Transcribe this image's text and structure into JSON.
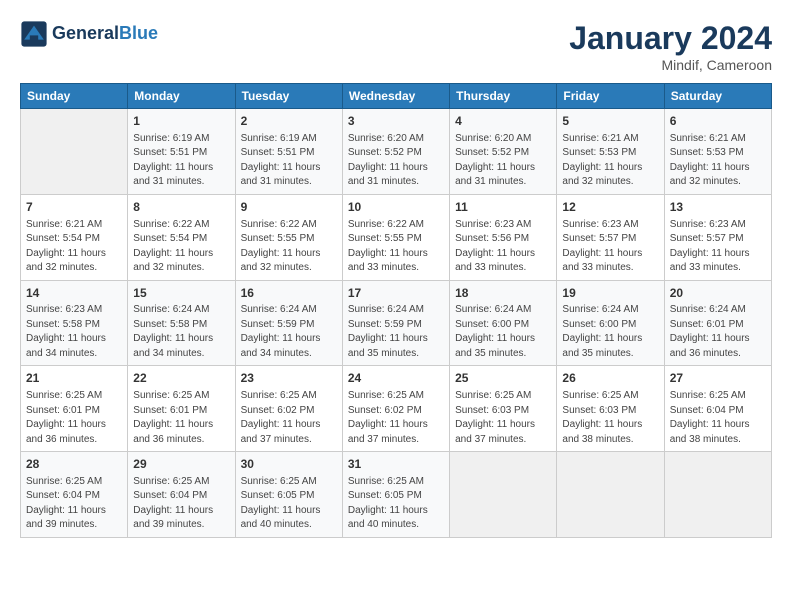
{
  "header": {
    "logo_general": "General",
    "logo_blue": "Blue",
    "month_title": "January 2024",
    "location": "Mindif, Cameroon"
  },
  "weekdays": [
    "Sunday",
    "Monday",
    "Tuesday",
    "Wednesday",
    "Thursday",
    "Friday",
    "Saturday"
  ],
  "weeks": [
    [
      {
        "day": "",
        "info": ""
      },
      {
        "day": "1",
        "info": "Sunrise: 6:19 AM\nSunset: 5:51 PM\nDaylight: 11 hours\nand 31 minutes."
      },
      {
        "day": "2",
        "info": "Sunrise: 6:19 AM\nSunset: 5:51 PM\nDaylight: 11 hours\nand 31 minutes."
      },
      {
        "day": "3",
        "info": "Sunrise: 6:20 AM\nSunset: 5:52 PM\nDaylight: 11 hours\nand 31 minutes."
      },
      {
        "day": "4",
        "info": "Sunrise: 6:20 AM\nSunset: 5:52 PM\nDaylight: 11 hours\nand 31 minutes."
      },
      {
        "day": "5",
        "info": "Sunrise: 6:21 AM\nSunset: 5:53 PM\nDaylight: 11 hours\nand 32 minutes."
      },
      {
        "day": "6",
        "info": "Sunrise: 6:21 AM\nSunset: 5:53 PM\nDaylight: 11 hours\nand 32 minutes."
      }
    ],
    [
      {
        "day": "7",
        "info": "Sunrise: 6:21 AM\nSunset: 5:54 PM\nDaylight: 11 hours\nand 32 minutes."
      },
      {
        "day": "8",
        "info": "Sunrise: 6:22 AM\nSunset: 5:54 PM\nDaylight: 11 hours\nand 32 minutes."
      },
      {
        "day": "9",
        "info": "Sunrise: 6:22 AM\nSunset: 5:55 PM\nDaylight: 11 hours\nand 32 minutes."
      },
      {
        "day": "10",
        "info": "Sunrise: 6:22 AM\nSunset: 5:55 PM\nDaylight: 11 hours\nand 33 minutes."
      },
      {
        "day": "11",
        "info": "Sunrise: 6:23 AM\nSunset: 5:56 PM\nDaylight: 11 hours\nand 33 minutes."
      },
      {
        "day": "12",
        "info": "Sunrise: 6:23 AM\nSunset: 5:57 PM\nDaylight: 11 hours\nand 33 minutes."
      },
      {
        "day": "13",
        "info": "Sunrise: 6:23 AM\nSunset: 5:57 PM\nDaylight: 11 hours\nand 33 minutes."
      }
    ],
    [
      {
        "day": "14",
        "info": "Sunrise: 6:23 AM\nSunset: 5:58 PM\nDaylight: 11 hours\nand 34 minutes."
      },
      {
        "day": "15",
        "info": "Sunrise: 6:24 AM\nSunset: 5:58 PM\nDaylight: 11 hours\nand 34 minutes."
      },
      {
        "day": "16",
        "info": "Sunrise: 6:24 AM\nSunset: 5:59 PM\nDaylight: 11 hours\nand 34 minutes."
      },
      {
        "day": "17",
        "info": "Sunrise: 6:24 AM\nSunset: 5:59 PM\nDaylight: 11 hours\nand 35 minutes."
      },
      {
        "day": "18",
        "info": "Sunrise: 6:24 AM\nSunset: 6:00 PM\nDaylight: 11 hours\nand 35 minutes."
      },
      {
        "day": "19",
        "info": "Sunrise: 6:24 AM\nSunset: 6:00 PM\nDaylight: 11 hours\nand 35 minutes."
      },
      {
        "day": "20",
        "info": "Sunrise: 6:24 AM\nSunset: 6:01 PM\nDaylight: 11 hours\nand 36 minutes."
      }
    ],
    [
      {
        "day": "21",
        "info": "Sunrise: 6:25 AM\nSunset: 6:01 PM\nDaylight: 11 hours\nand 36 minutes."
      },
      {
        "day": "22",
        "info": "Sunrise: 6:25 AM\nSunset: 6:01 PM\nDaylight: 11 hours\nand 36 minutes."
      },
      {
        "day": "23",
        "info": "Sunrise: 6:25 AM\nSunset: 6:02 PM\nDaylight: 11 hours\nand 37 minutes."
      },
      {
        "day": "24",
        "info": "Sunrise: 6:25 AM\nSunset: 6:02 PM\nDaylight: 11 hours\nand 37 minutes."
      },
      {
        "day": "25",
        "info": "Sunrise: 6:25 AM\nSunset: 6:03 PM\nDaylight: 11 hours\nand 37 minutes."
      },
      {
        "day": "26",
        "info": "Sunrise: 6:25 AM\nSunset: 6:03 PM\nDaylight: 11 hours\nand 38 minutes."
      },
      {
        "day": "27",
        "info": "Sunrise: 6:25 AM\nSunset: 6:04 PM\nDaylight: 11 hours\nand 38 minutes."
      }
    ],
    [
      {
        "day": "28",
        "info": "Sunrise: 6:25 AM\nSunset: 6:04 PM\nDaylight: 11 hours\nand 39 minutes."
      },
      {
        "day": "29",
        "info": "Sunrise: 6:25 AM\nSunset: 6:04 PM\nDaylight: 11 hours\nand 39 minutes."
      },
      {
        "day": "30",
        "info": "Sunrise: 6:25 AM\nSunset: 6:05 PM\nDaylight: 11 hours\nand 40 minutes."
      },
      {
        "day": "31",
        "info": "Sunrise: 6:25 AM\nSunset: 6:05 PM\nDaylight: 11 hours\nand 40 minutes."
      },
      {
        "day": "",
        "info": ""
      },
      {
        "day": "",
        "info": ""
      },
      {
        "day": "",
        "info": ""
      }
    ]
  ]
}
